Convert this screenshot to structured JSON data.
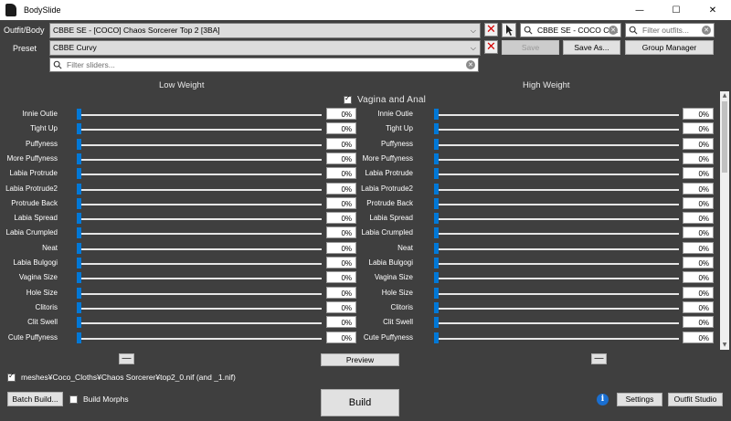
{
  "window": {
    "title": "BodySlide",
    "minimize": "—",
    "maximize": "☐",
    "close": "✕"
  },
  "outfit": {
    "label": "Outfit/Body",
    "value": "CBBE SE - [COCO] Chaos Sorcerer Top 2 [3BA]",
    "group_filter_value": "CBBE SE - COCO Cha",
    "outfit_filter_placeholder": "Filter outfits..."
  },
  "preset": {
    "label": "Preset",
    "value": "CBBE Curvy",
    "save_label": "Save",
    "save_as_label": "Save As...",
    "group_manager_label": "Group Manager"
  },
  "slider_filter": {
    "placeholder": "Filter sliders..."
  },
  "panel": {
    "low_weight": "Low Weight",
    "high_weight": "High Weight",
    "category": "Vagina and Anal"
  },
  "sliders": [
    {
      "name": "Innie Outie",
      "low": "0%",
      "high": "0%"
    },
    {
      "name": "Tight Up",
      "low": "0%",
      "high": "0%"
    },
    {
      "name": "Puffyness",
      "low": "0%",
      "high": "0%"
    },
    {
      "name": "More Puffyness",
      "low": "0%",
      "high": "0%"
    },
    {
      "name": "Labia Protrude",
      "low": "0%",
      "high": "0%"
    },
    {
      "name": "Labia Protrude2",
      "low": "0%",
      "high": "0%"
    },
    {
      "name": "Protrude Back",
      "low": "0%",
      "high": "0%"
    },
    {
      "name": "Labia Spread",
      "low": "0%",
      "high": "0%"
    },
    {
      "name": "Labia Crumpled",
      "low": "0%",
      "high": "0%"
    },
    {
      "name": "Neat",
      "low": "0%",
      "high": "0%"
    },
    {
      "name": "Labia Bulgogi",
      "low": "0%",
      "high": "0%"
    },
    {
      "name": "Vagina Size",
      "low": "0%",
      "high": "0%"
    },
    {
      "name": "Hole Size",
      "low": "0%",
      "high": "0%"
    },
    {
      "name": "Clitoris",
      "low": "0%",
      "high": "0%"
    },
    {
      "name": "Clit Swell",
      "low": "0%",
      "high": "0%"
    },
    {
      "name": "Cute Puffyness",
      "low": "0%",
      "high": "0%"
    }
  ],
  "bottom": {
    "preview_label": "Preview",
    "minus_label": "—",
    "output_path": "meshes¥Coco_Cloths¥Chaos Sorcerer¥top2_0.nif (and _1.nif)",
    "batch_build_label": "Batch Build...",
    "build_morphs_label": "Build Morphs",
    "build_label": "Build",
    "settings_label": "Settings",
    "outfit_studio_label": "Outfit Studio",
    "info_glyph": "i"
  }
}
